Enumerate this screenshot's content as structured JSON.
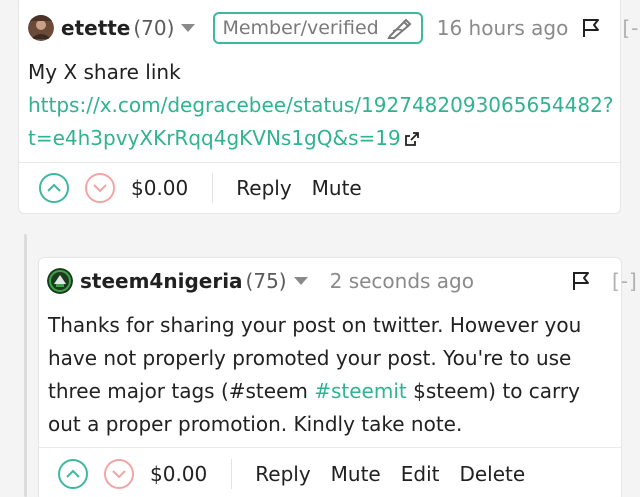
{
  "colors": {
    "accent": "#3fb8a0",
    "link": "#2fb391",
    "downvote": "#f2a5a5"
  },
  "comments": [
    {
      "author": "etette",
      "reputation": "(70)",
      "badge": "Member/verified",
      "time": "16 hours ago",
      "collapse": "[-]",
      "text_line1": "My X share link",
      "link": "https://x.com/degracebee/status/1927482093065654482?t=e4h3pvyXKrRqq4gKVNs1gQ&s=19",
      "link_line1": "https://x.com/degracebee/status/1927482093065654482?",
      "link_line2": "t=e4h3pvyXKrRqq4gKVNs1gQ&s=19",
      "payout": "$0.00",
      "actions": {
        "reply": "Reply",
        "mute": "Mute"
      }
    },
    {
      "author": "steem4nigeria",
      "reputation": "(75)",
      "time": "2 seconds ago",
      "collapse": "[-]",
      "text_before_tag": "Thanks for sharing your post on twitter. However you have not properly promoted your post. You're to use three major tags (#steem ",
      "tag": "#steemit",
      "text_after_tag": " $steem) to carry out a proper promotion. Kindly take note.",
      "payout": "$0.00",
      "actions": {
        "reply": "Reply",
        "mute": "Mute",
        "edit": "Edit",
        "delete": "Delete"
      }
    }
  ]
}
